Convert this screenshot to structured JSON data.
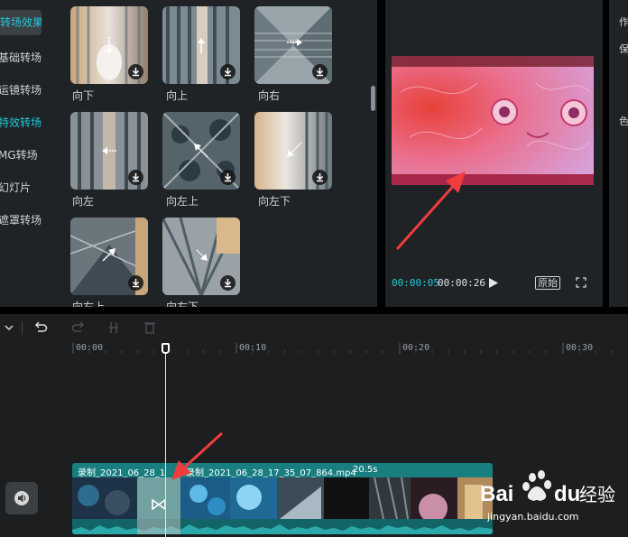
{
  "sidebar": {
    "items": [
      {
        "label": "转场效果",
        "active": true
      },
      {
        "label": "基础转场"
      },
      {
        "label": "运镜转场"
      },
      {
        "label": "特效转场",
        "active": true
      },
      {
        "label": "MG转场"
      },
      {
        "label": "幻灯片"
      },
      {
        "label": "遮罩转场"
      }
    ]
  },
  "transitions": {
    "items": [
      {
        "label": "向下",
        "icon": "arrow-down-icon"
      },
      {
        "label": "向上",
        "icon": "arrow-up-icon"
      },
      {
        "label": "向右",
        "icon": "arrow-right-icon"
      },
      {
        "label": "向左",
        "icon": "arrow-left-icon"
      },
      {
        "label": "向左上",
        "icon": "arrow-up-left-icon"
      },
      {
        "label": "向左下",
        "icon": "arrow-down-left-icon"
      },
      {
        "label": "向右上",
        "icon": "arrow-up-right-icon"
      },
      {
        "label": "向右下",
        "icon": "arrow-down-right-icon"
      }
    ],
    "download_icon": "download-icon"
  },
  "preview": {
    "current_time": "00:00:05",
    "total_time": "00:00:26",
    "play_icon": "play-icon",
    "original_label": "原始",
    "fullscreen_icon": "fullscreen-icon",
    "side_texts": [
      "作",
      "保",
      "色"
    ]
  },
  "timeline": {
    "ruler_labels": [
      "00:00",
      "00:10",
      "00:20",
      "00:30"
    ],
    "clip_a_title": "录制_2021_06_28_1",
    "clip_b_title": "录制_2021_06_28_17_35_07_864.mp4",
    "clip_b_duration": "20.5s",
    "icons": [
      "dropdown-icon",
      "undo-icon",
      "redo-icon",
      "split-icon",
      "delete-icon"
    ]
  },
  "watermark": {
    "brand_a": "Bai",
    "brand_b": "du",
    "brand_c": "经验",
    "url": "jingyan.baidu.com"
  },
  "colors": {
    "accent": "#1fc9d9",
    "panel": "#1f2326",
    "track": "#187e80",
    "annotation_arrow": "#f03c3c"
  }
}
